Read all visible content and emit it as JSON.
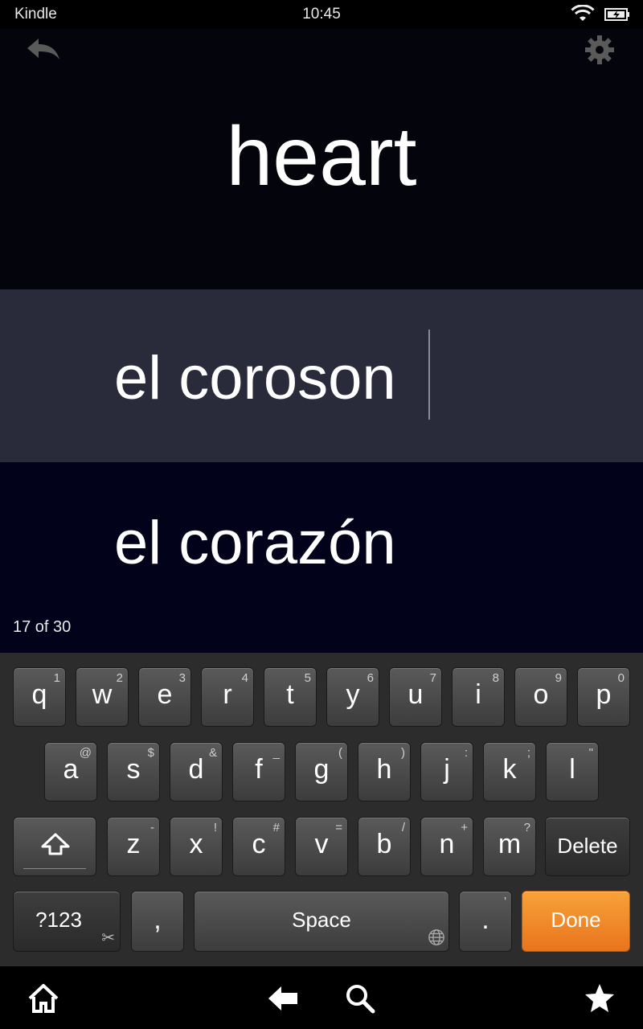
{
  "status": {
    "app": "Kindle",
    "time": "10:45"
  },
  "card": {
    "prompt": "heart",
    "answer": "el coroson",
    "correct": "el corazón",
    "progress": "17 of 30"
  },
  "keyboard": {
    "row1": [
      {
        "main": "q",
        "alt": "1"
      },
      {
        "main": "w",
        "alt": "2"
      },
      {
        "main": "e",
        "alt": "3"
      },
      {
        "main": "r",
        "alt": "4"
      },
      {
        "main": "t",
        "alt": "5"
      },
      {
        "main": "y",
        "alt": "6"
      },
      {
        "main": "u",
        "alt": "7"
      },
      {
        "main": "i",
        "alt": "8"
      },
      {
        "main": "o",
        "alt": "9"
      },
      {
        "main": "p",
        "alt": "0"
      }
    ],
    "row2": [
      {
        "main": "a",
        "alt": "@"
      },
      {
        "main": "s",
        "alt": "$"
      },
      {
        "main": "d",
        "alt": "&"
      },
      {
        "main": "f",
        "alt": "_"
      },
      {
        "main": "g",
        "alt": "("
      },
      {
        "main": "h",
        "alt": ")"
      },
      {
        "main": "j",
        "alt": ":"
      },
      {
        "main": "k",
        "alt": ";"
      },
      {
        "main": "l",
        "alt": "\""
      }
    ],
    "row3": [
      {
        "main": "z",
        "alt": "-"
      },
      {
        "main": "x",
        "alt": "!"
      },
      {
        "main": "c",
        "alt": "#"
      },
      {
        "main": "v",
        "alt": "="
      },
      {
        "main": "b",
        "alt": "/"
      },
      {
        "main": "n",
        "alt": "+"
      },
      {
        "main": "m",
        "alt": "?"
      }
    ],
    "delete_label": "Delete",
    "symbols_label": "?123",
    "comma": ",",
    "space_label": "Space",
    "period": ".",
    "period_alt": "'",
    "done_label": "Done"
  },
  "colors": {
    "accent": "#f08a28",
    "answer_bg": "#2a2b3a",
    "correct_bg": "#02021a"
  }
}
